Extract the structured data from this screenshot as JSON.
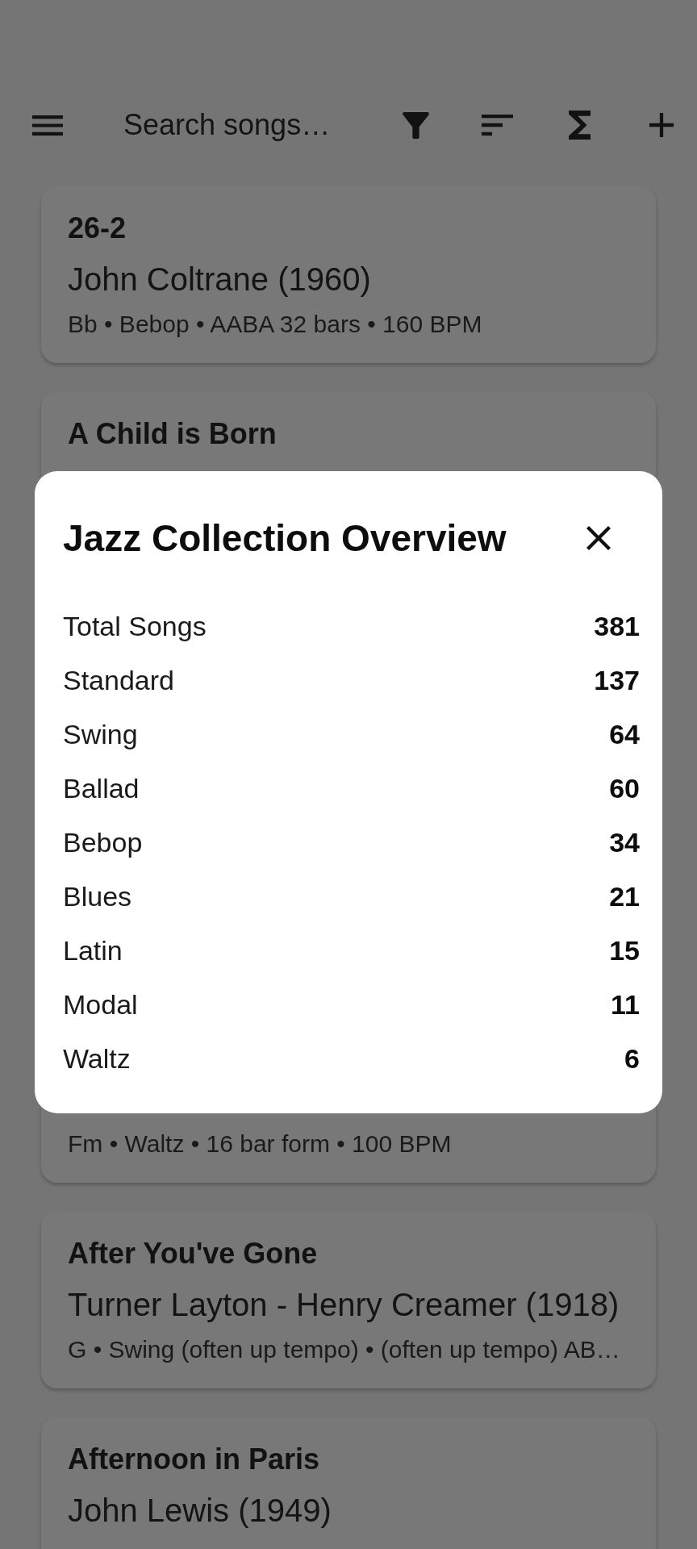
{
  "toolbar": {
    "search": {
      "placeholder": "Search songs…"
    }
  },
  "songs": [
    {
      "title": "26-2",
      "composer": "John Coltrane (1960)",
      "details": "Bb • Bebop • AABA 32 bars • 160 BPM"
    },
    {
      "title": "A Child is Born"
    },
    {
      "details": "Fm • Waltz • 16 bar form • 100 BPM"
    },
    {
      "title": "After You've Gone",
      "composer": "Turner Layton - Henry Creamer (1918)",
      "details": "G • Swing (often up tempo) • (often up tempo) AB…"
    },
    {
      "title": "Afternoon in Paris",
      "composer": "John Lewis (1949)"
    }
  ],
  "dialog": {
    "title": "Jazz Collection Overview",
    "stats": [
      {
        "label": "Total Songs",
        "value": "381"
      },
      {
        "label": "Standard",
        "value": "137"
      },
      {
        "label": "Swing",
        "value": "64"
      },
      {
        "label": "Ballad",
        "value": "60"
      },
      {
        "label": "Bebop",
        "value": "34"
      },
      {
        "label": "Blues",
        "value": "21"
      },
      {
        "label": "Latin",
        "value": "15"
      },
      {
        "label": "Modal",
        "value": "11"
      },
      {
        "label": "Waltz",
        "value": "6"
      }
    ]
  }
}
